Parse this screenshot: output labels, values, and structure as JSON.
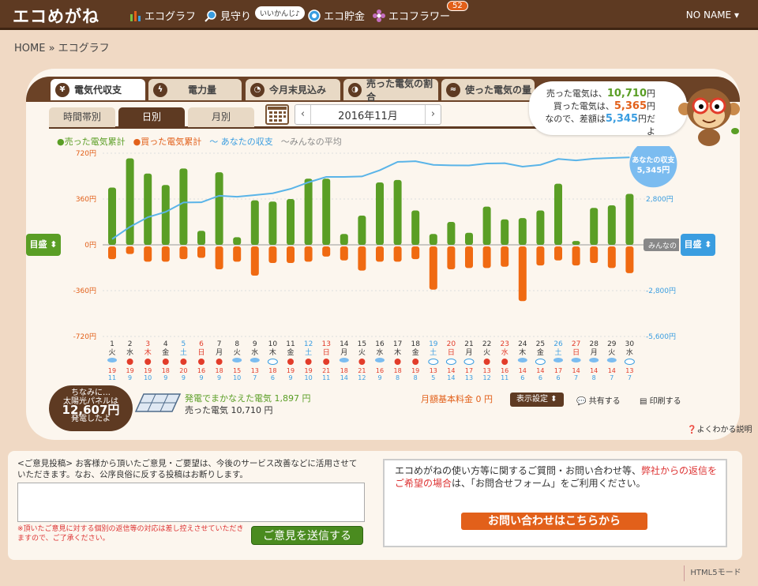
{
  "header": {
    "logo": "エコめがね",
    "nav": [
      "エコグラフ",
      "見守り",
      "エコ貯金",
      "エコフラワー"
    ],
    "iikanji": "いいかんじ♪",
    "flower_badge": "52",
    "user": "NO NAME"
  },
  "breadcrumb": "HOME » エコグラフ",
  "tabs": [
    "電気代収支",
    "電力量",
    "今月末見込み",
    "売った電気の割合",
    "使った電気の量"
  ],
  "subtabs": [
    "時間帯別",
    "日別",
    "月別"
  ],
  "date_nav": {
    "prev": "‹",
    "label": "2016年11月",
    "next": "›"
  },
  "bubble": {
    "sold_prefix": "売った電気は、",
    "sold_value": "10,710",
    "sold_unit": "円",
    "bought_prefix": "買った電気は、",
    "bought_value": "5,365",
    "bought_unit": "円",
    "diff_prefix": "なので、差額は",
    "diff_value": "5,345",
    "diff_unit": "円だよ"
  },
  "legend": [
    "●売った電気累計",
    "●買った電気累計",
    "〜 あなたの収支",
    "〜みんなの平均"
  ],
  "side_buttons": {
    "left": "目盛 ⬍",
    "right": "目盛 ⬍"
  },
  "balance_label": {
    "title": "あなたの収支",
    "value": "5,345円"
  },
  "average_label": "みんなの",
  "chart_data": {
    "type": "bar",
    "days": [
      "1",
      "2",
      "3",
      "4",
      "5",
      "6",
      "7",
      "8",
      "9",
      "10",
      "11",
      "12",
      "13",
      "14",
      "15",
      "16",
      "17",
      "18",
      "19",
      "20",
      "21",
      "22",
      "23",
      "24",
      "25",
      "26",
      "27",
      "28",
      "29",
      "30"
    ],
    "weekdays": [
      "火",
      "水",
      "木",
      "金",
      "土",
      "日",
      "月",
      "火",
      "水",
      "木",
      "金",
      "土",
      "日",
      "月",
      "火",
      "水",
      "木",
      "金",
      "土",
      "日",
      "月",
      "火",
      "水",
      "木",
      "金",
      "土",
      "日",
      "月",
      "火",
      "水"
    ],
    "day_colors": [
      "n",
      "n",
      "r",
      "n",
      "b",
      "r",
      "n",
      "n",
      "n",
      "n",
      "n",
      "b",
      "r",
      "n",
      "n",
      "n",
      "n",
      "n",
      "b",
      "r",
      "n",
      "n",
      "r",
      "n",
      "n",
      "b",
      "r",
      "n",
      "n",
      "n"
    ],
    "weather": [
      "rain",
      "sun",
      "sun",
      "sun",
      "sun",
      "sun",
      "sun",
      "rain",
      "rain",
      "cloud",
      "sun",
      "sun",
      "sun",
      "rain",
      "sun",
      "rain",
      "sun",
      "sun",
      "cloud",
      "cloud",
      "cloud",
      "sun",
      "sun",
      "rain",
      "cloud",
      "rain",
      "rain",
      "rain",
      "rain",
      "cloud"
    ],
    "temp_high": [
      19,
      19,
      19,
      18,
      20,
      16,
      18,
      15,
      13,
      18,
      19,
      19,
      21,
      18,
      21,
      16,
      18,
      19,
      13,
      14,
      17,
      13,
      16,
      14,
      14,
      17,
      14,
      14,
      14,
      13
    ],
    "temp_low": [
      11,
      9,
      10,
      9,
      9,
      9,
      9,
      10,
      7,
      6,
      9,
      10,
      11,
      14,
      12,
      9,
      8,
      8,
      5,
      14,
      13,
      12,
      11,
      6,
      6,
      6,
      7,
      8,
      7,
      7
    ],
    "sold": [
      450,
      680,
      560,
      470,
      600,
      110,
      570,
      60,
      350,
      340,
      360,
      520,
      520,
      85,
      230,
      490,
      510,
      270,
      85,
      180,
      95,
      300,
      200,
      210,
      270,
      480,
      30,
      290,
      310,
      400
    ],
    "bought": [
      -100,
      -60,
      -120,
      -120,
      -100,
      -90,
      -180,
      -120,
      -230,
      -130,
      -130,
      -120,
      -80,
      -110,
      -190,
      -120,
      -120,
      -100,
      -340,
      -180,
      -170,
      -170,
      -160,
      -430,
      -150,
      -110,
      -150,
      -130,
      -170,
      -210
    ],
    "balance_cum": [
      350,
      1100,
      1690,
      2010,
      2590,
      2600,
      3000,
      2940,
      3040,
      3150,
      3420,
      3820,
      4150,
      4150,
      4180,
      4560,
      5070,
      5110,
      4890,
      4860,
      4850,
      4970,
      4990,
      4780,
      4890,
      5250,
      5160,
      5270,
      5310,
      5345
    ],
    "left_ylim": [
      -720,
      720
    ],
    "left_ticks": [
      "720円",
      "360円",
      "0円",
      "-360円",
      "-720円"
    ],
    "right_ylim": [
      -5600,
      5600
    ],
    "right_ticks": [
      "2,800円",
      "-2,800円",
      "-5,600円"
    ]
  },
  "solar": {
    "line1": "ちなみに…",
    "line2": "太陽光パネルは",
    "value": "12,607円",
    "line3": "発電したよ"
  },
  "gen_stats": {
    "covered_label": "発電でまかなえた電気",
    "covered_value": "1,897 円",
    "sold_label": "売った電気",
    "sold_value": "10,710 円"
  },
  "base_fee": "月額基本料金 0 円",
  "display_settings": "表示設定 ⬍",
  "share": "共有する",
  "print": "印刷する",
  "help": "よくわかる説明",
  "feedback": {
    "intro": "<ご意見投稿> お客様から頂いたご意見・ご要望は、今後のサービス改善などに活用させていただきます。なお、公序良俗に反する投稿はお断りします。",
    "note": "※頂いたご意見に対する個別の返信等の対応は差し控えさせていただきますので、ご了承ください。",
    "submit": "ご意見を送信する"
  },
  "contact": {
    "text1": "エコめがねの使い方等に関するご質問・お問い合わせ等、",
    "text_red": "弊社からの返信をご希望の場合",
    "text2": "は、「お問合せフォーム」をご利用ください。",
    "button": "お問い合わせはこちらから"
  },
  "footer": {
    "html5": "HTML5モード"
  }
}
